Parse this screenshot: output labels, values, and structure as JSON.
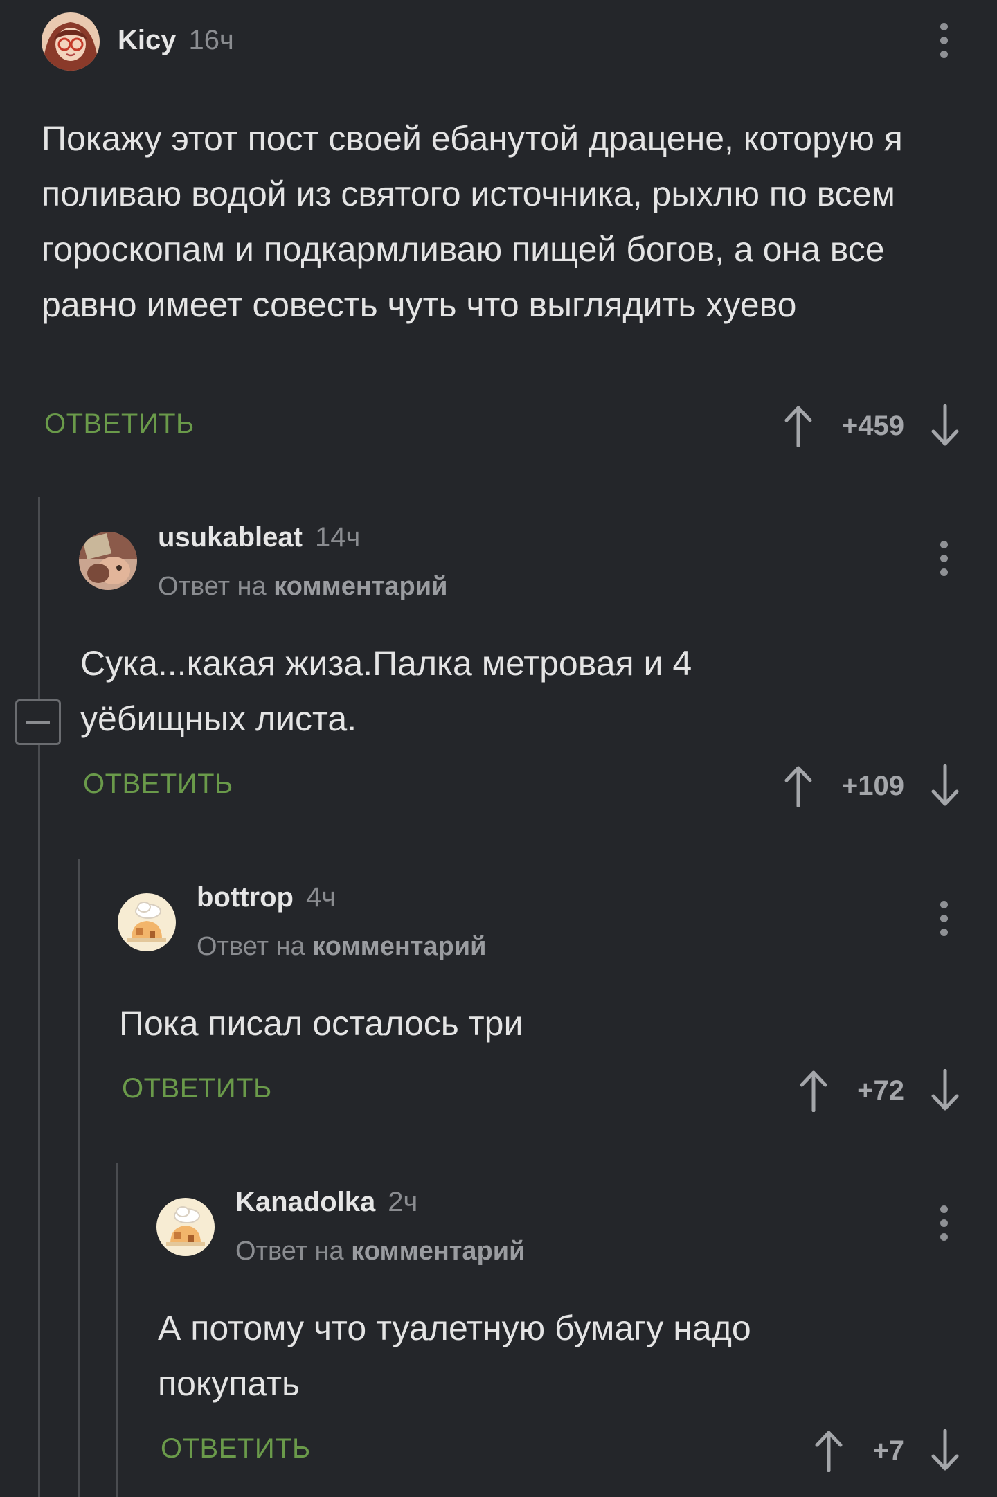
{
  "comments": [
    {
      "author": "Kicy",
      "time": "16ч",
      "reply_prefix": "",
      "reply_target": "",
      "text": "Покажу этот пост своей ебанутой драцене, которую я поливаю водой из святого источника, рыхлю по всем гороскопам и подкармливаю пищей богов, а она все равно имеет совесть чуть что выглядить хуево",
      "reply_label": "ОТВЕТИТЬ",
      "score": "+459"
    },
    {
      "author": "usukableat",
      "time": "14ч",
      "reply_prefix": "Ответ на",
      "reply_target": "комментарий",
      "text": "Сука...какая жиза.Палка метровая и 4 уёбищных листа.",
      "reply_label": "ОТВЕТИТЬ",
      "score": "+109"
    },
    {
      "author": "bottrop",
      "time": "4ч",
      "reply_prefix": "Ответ на",
      "reply_target": "комментарий",
      "text": "Пока писал осталось три",
      "reply_label": "ОТВЕТИТЬ",
      "score": "+72"
    },
    {
      "author": "Kanadolka",
      "time": "2ч",
      "reply_prefix": "Ответ на",
      "reply_target": "комментарий",
      "text": "А потому что туалетную бумагу надо покупать",
      "reply_label": "ОТВЕТИТЬ",
      "score": "+7"
    }
  ],
  "icons": {
    "upvote": "arrow-up-icon",
    "downvote": "arrow-down-icon",
    "more": "more-vertical-icon",
    "collapse": "minus-icon"
  },
  "colors": {
    "background": "#24262a",
    "reply_green": "#6a9a4a",
    "thread_line": "#4a4c50"
  }
}
